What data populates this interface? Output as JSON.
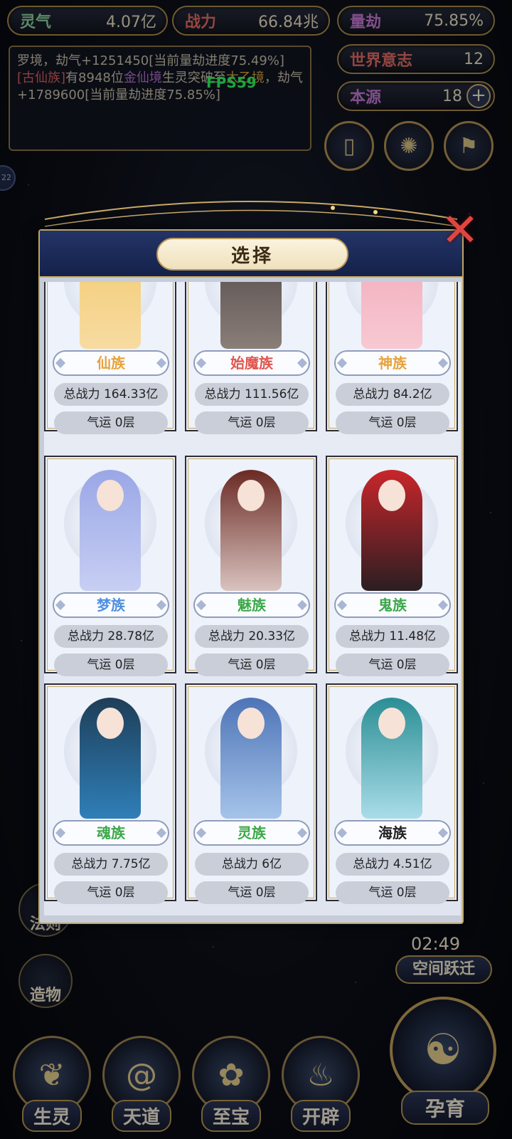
{
  "hud": {
    "stats_left": [
      {
        "label": "灵气",
        "value": "4.07亿",
        "color": "#8fd4a0"
      },
      {
        "label": "战力",
        "value": "66.84兆",
        "color": "#e36c63"
      }
    ],
    "stats_right": [
      {
        "label": "量劫",
        "value": "75.85%",
        "color": "#c77ad6"
      },
      {
        "label": "世界意志",
        "value": "12",
        "color": "#e36c63"
      },
      {
        "label": "本源",
        "value": "18",
        "color": "#c77ad6"
      }
    ],
    "plus_icon": "plus-icon",
    "fps": "FPS59",
    "side_badge": "22"
  },
  "log": {
    "line1_a": "罗境，劫气+1251450[当前量劫进度75.49%]",
    "line2_tag": "[古仙族]",
    "line2_a": "有8948位",
    "line2_realm": "金仙境",
    "line2_b": "生灵突破至",
    "line2_target": "太乙境",
    "line2_c": "，劫气+1789600[当前量劫进度75.85%]"
  },
  "modal": {
    "title": "选择",
    "close_icon": "close-icon",
    "cards": [
      {
        "name": "仙族",
        "name_color": "#e8a23a",
        "power": "总战力 164.33亿",
        "luck": "气运 0层",
        "palette": [
          "#f2c96b",
          "#f7dba2"
        ]
      },
      {
        "name": "始魔族",
        "name_color": "#e0574f",
        "power": "总战力 111.56亿",
        "luck": "气运 0层",
        "palette": [
          "#4a4345",
          "#8a7e78"
        ]
      },
      {
        "name": "神族",
        "name_color": "#e8a23a",
        "power": "总战力 84.2亿",
        "luck": "气运 0层",
        "palette": [
          "#f2a6b8",
          "#f7c9d2"
        ]
      },
      {
        "name": "梦族",
        "name_color": "#4f8fe0",
        "power": "总战力 28.78亿",
        "luck": "气运 0层",
        "palette": [
          "#9aa7e6",
          "#c7cff3"
        ]
      },
      {
        "name": "魅族",
        "name_color": "#3ca84a",
        "power": "总战力 20.33亿",
        "luck": "气运 0层",
        "palette": [
          "#6b2a24",
          "#d9c3bf"
        ]
      },
      {
        "name": "鬼族",
        "name_color": "#3ca84a",
        "power": "总战力 11.48亿",
        "luck": "气运 0层",
        "palette": [
          "#c8262b",
          "#2b1e22"
        ]
      },
      {
        "name": "魂族",
        "name_color": "#3ca84a",
        "power": "总战力 7.75亿",
        "luck": "气运 0层",
        "palette": [
          "#1e3e58",
          "#2f7fb8"
        ]
      },
      {
        "name": "灵族",
        "name_color": "#3ca84a",
        "power": "总战力 6亿",
        "luck": "气运 0层",
        "palette": [
          "#4d74b6",
          "#a6c4ea"
        ]
      },
      {
        "name": "海族",
        "name_color": "#222222",
        "power": "总战力 4.51亿",
        "luck": "气运 0层",
        "palette": [
          "#2b8e95",
          "#a9dde8"
        ]
      }
    ]
  },
  "right_side": {
    "icons": [
      "card-icon",
      "vortex-icon",
      "banner-icon"
    ],
    "timer": "02:49",
    "space_jump": "空间跃迁"
  },
  "left_side": {
    "rules": "法则",
    "creation": "造物"
  },
  "bottom_nav": [
    {
      "label": "生灵",
      "icon": "phoenix-icon"
    },
    {
      "label": "天道",
      "icon": "swirl-icon"
    },
    {
      "label": "至宝",
      "icon": "lotus-icon"
    },
    {
      "label": "开辟",
      "icon": "flame-icon"
    }
  ],
  "birth": {
    "label": "孕育",
    "icon": "embryo-icon"
  }
}
